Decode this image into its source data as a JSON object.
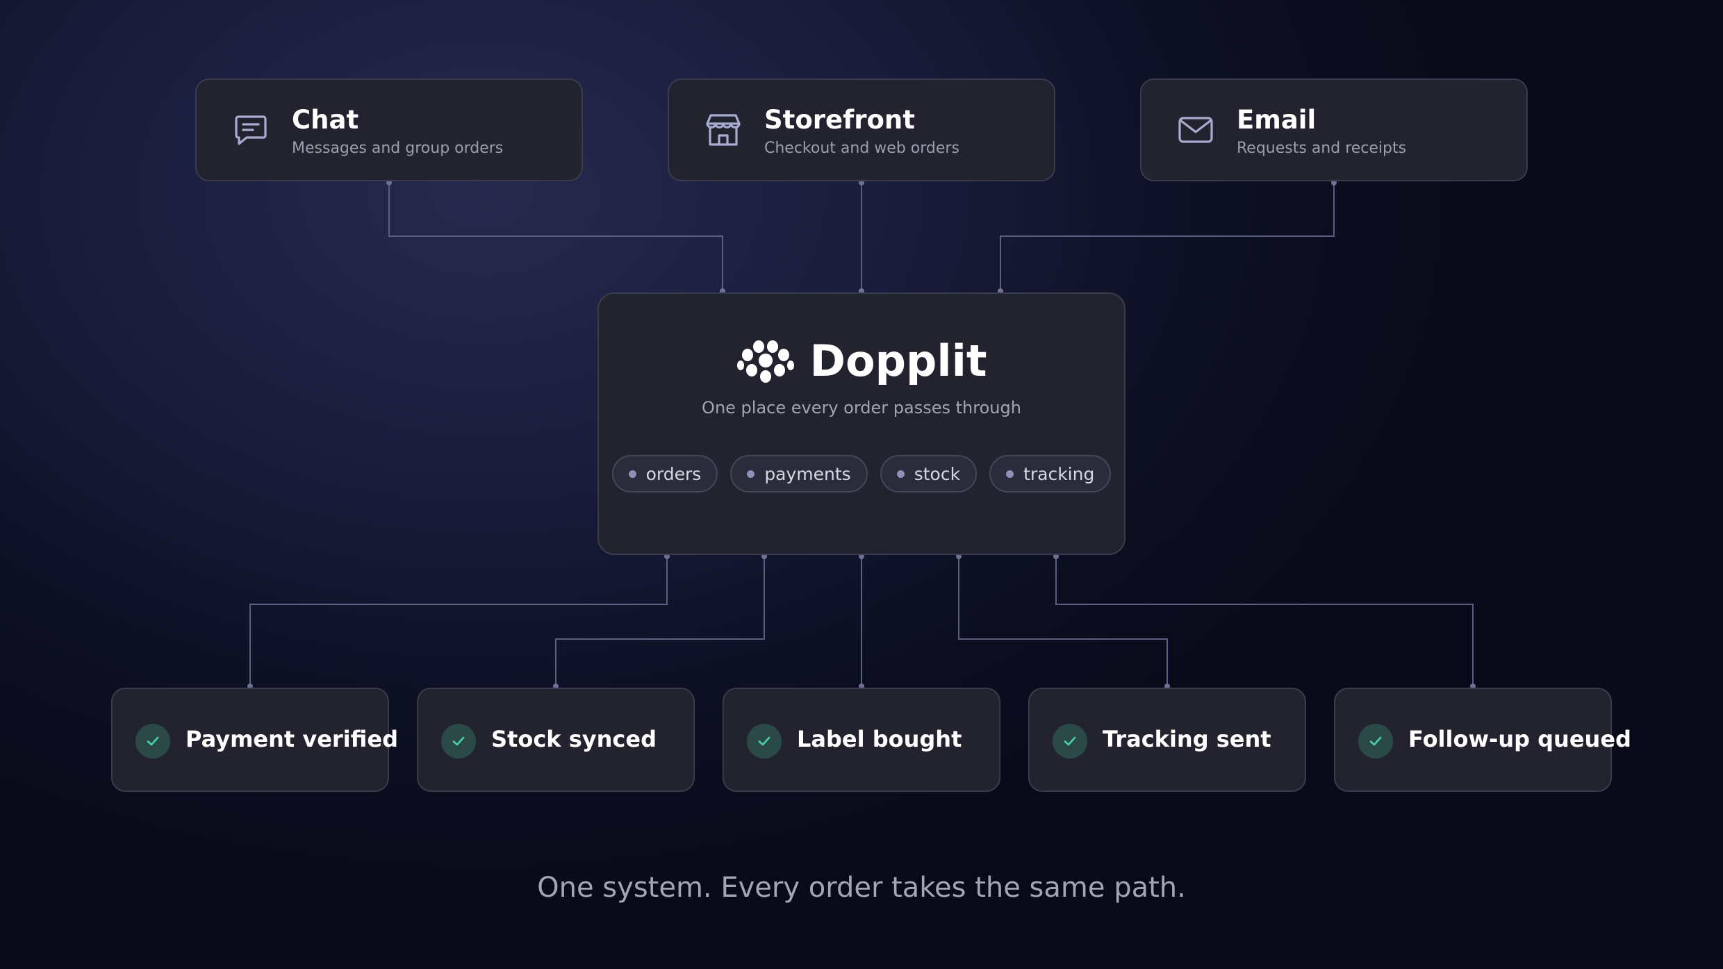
{
  "sources": [
    {
      "title": "Chat",
      "subtitle": "Messages and group orders",
      "icon": "chat-icon"
    },
    {
      "title": "Storefront",
      "subtitle": "Checkout and web orders",
      "icon": "storefront-icon"
    },
    {
      "title": "Email",
      "subtitle": "Requests and receipts",
      "icon": "mail-icon"
    }
  ],
  "hub": {
    "brand": "Dopplit",
    "logo_icon": "dopplit-logo-icon",
    "tagline": "One place every order passes through",
    "tags": [
      "orders",
      "payments",
      "stock",
      "tracking"
    ]
  },
  "outputs": [
    {
      "label": "Payment verified",
      "icon": "check-icon"
    },
    {
      "label": "Stock synced",
      "icon": "check-icon"
    },
    {
      "label": "Label bought",
      "icon": "check-icon"
    },
    {
      "label": "Tracking sent",
      "icon": "check-icon"
    },
    {
      "label": "Follow-up queued",
      "icon": "check-icon"
    }
  ],
  "footer": "One system. Every order takes the same path.",
  "colors": {
    "background": "#0d0f22",
    "card": "#22232f",
    "card_border": "#3a3c4d",
    "connector": "#5b5e7e",
    "check_badge": "#2b4a47",
    "check_mark": "#49d3a2",
    "muted_text": "#a3a5b4"
  }
}
